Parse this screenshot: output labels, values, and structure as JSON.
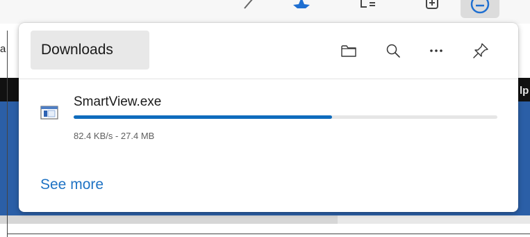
{
  "flyout": {
    "title": "Downloads",
    "actions": {
      "open_folder_icon": "folder-icon",
      "search_icon": "search-icon",
      "more_icon": "more-options-icon",
      "pin_icon": "pin-icon"
    }
  },
  "downloads": [
    {
      "file_name": "SmartView.exe",
      "status": "82.4 KB/s - 27.4 MB",
      "progress": 0.61,
      "icon": "executable-file-icon"
    }
  ],
  "footer": {
    "see_more_label": "See more"
  },
  "background": {
    "left_edge_letter": "a",
    "right_edge_letter": "lp"
  },
  "colors": {
    "accent": "#0f6cbd",
    "link": "#1f73c4",
    "title_pill_bg": "#e8e8e8"
  }
}
